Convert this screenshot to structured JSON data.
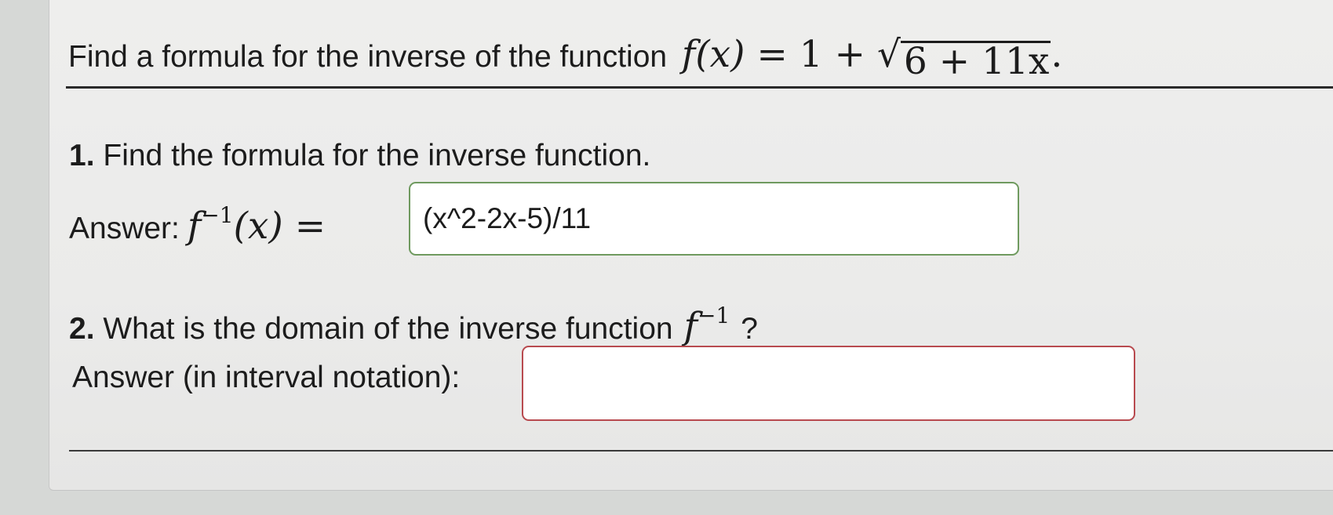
{
  "problem": {
    "prompt": "Find a formula for the inverse of the function",
    "function_lhs": "f(x)",
    "function_rhs_pre": "= 1 +",
    "radicand": "6 + 11x",
    "period": "."
  },
  "question1": {
    "number": "1.",
    "text": "Find the formula for the inverse function.",
    "answer_label": "Answer:",
    "answer_math_base": "f",
    "answer_math_sup": "−1",
    "answer_math_rest": "(x) =",
    "answer_value": "(x^2-2x-5)/11",
    "answer_state": "correct"
  },
  "question2": {
    "number": "2.",
    "text": "What is the domain of the inverse function",
    "math_base": "f",
    "math_sup": "−1",
    "question_mark": "?",
    "answer_label": "Answer (in interval notation):",
    "answer_value": "",
    "answer_state": "incorrect"
  },
  "colors": {
    "correct_border": "#6f9a5f",
    "incorrect_border": "#b84a4f",
    "page_background": "#ebebea"
  }
}
